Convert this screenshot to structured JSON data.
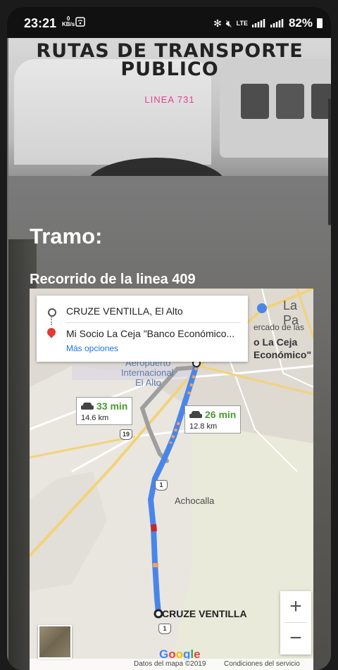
{
  "status_bar": {
    "time": "23:21",
    "net_speed": "0",
    "net_unit": "KB/s",
    "network": "LTE",
    "battery": "82%"
  },
  "hero": {
    "title": "RUTAS DE TRANSPORTE PUBLICO",
    "subtitle": "LINEA 731"
  },
  "section": {
    "heading": "Tramo:",
    "subheading": "Recorrido de la linea 409"
  },
  "map": {
    "directions": {
      "origin": "CRUZE VENTILLA, El Alto",
      "destination": "Mi Socio La Ceja \"Banco Económico...",
      "more_options": "Más opciones"
    },
    "routes": [
      {
        "time": "33 min",
        "distance": "14.6 km"
      },
      {
        "time": "26 min",
        "distance": "12.8 km"
      }
    ],
    "places": {
      "la_paz": "La Pa",
      "mercado": "ercado de las",
      "la_ceja_1": "o La Ceja",
      "la_ceja_2": "Económico\"",
      "airport_1": "Aeropuerto",
      "airport_2": "Internacional",
      "airport_3": "El Alto",
      "achocalla": "Achocalla",
      "end_marker": "CRUZE VENTILLA"
    },
    "road_shields": [
      "19",
      "1",
      "1"
    ],
    "zoom_in": "+",
    "zoom_out": "−",
    "brand": "Google",
    "attribution": "Datos del mapa ©2019",
    "terms": "Condiciones del servicio"
  }
}
